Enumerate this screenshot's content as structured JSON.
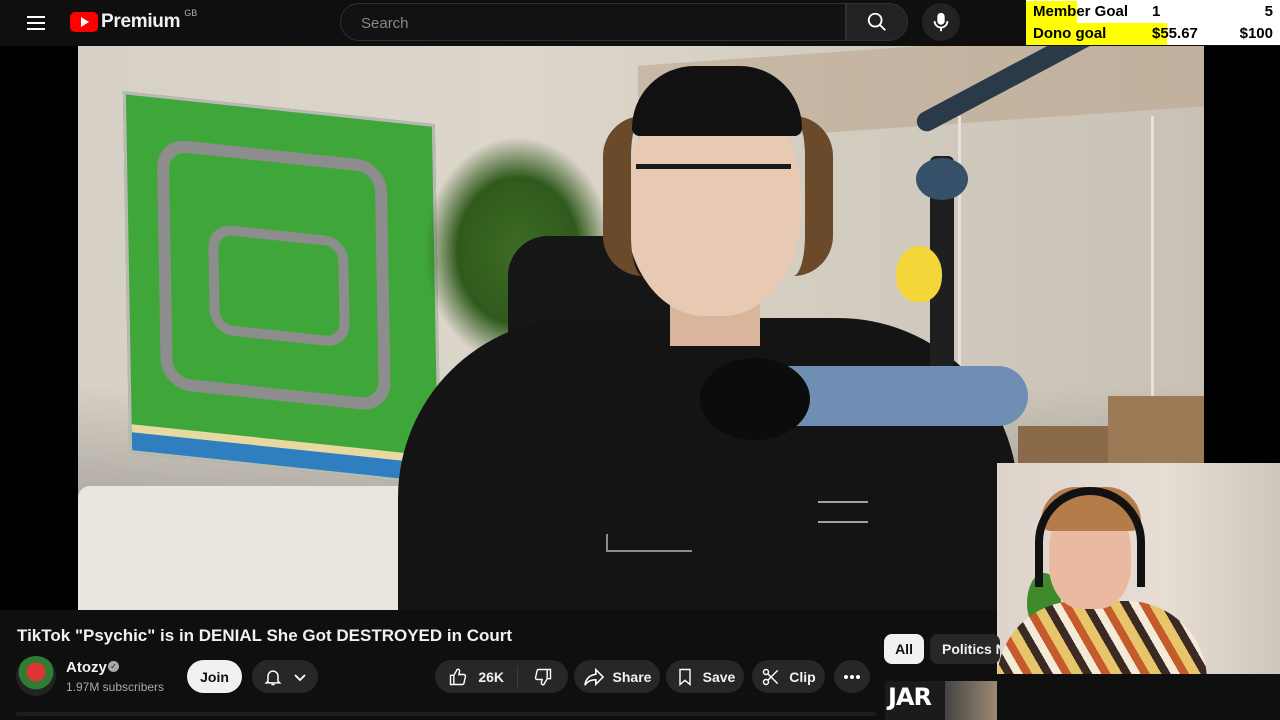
{
  "header": {
    "brand": "Premium",
    "region": "GB",
    "search_placeholder": "Search"
  },
  "overlay": {
    "rows": [
      {
        "label": "Member Goal",
        "current": "1",
        "target": "5",
        "progress": 0.2
      },
      {
        "label": "Dono goal",
        "current": "$55.67",
        "target": "$100",
        "progress": 0.5567
      }
    ]
  },
  "video": {
    "title": "TikTok \"Psychic\" is in DENIAL She Got DESTROYED in Court"
  },
  "channel": {
    "name": "Atozy",
    "subscribers": "1.97M subscribers",
    "join_label": "Join"
  },
  "actions": {
    "like_count": "26K",
    "share_label": "Share",
    "save_label": "Save",
    "clip_label": "Clip"
  },
  "chips": [
    "All",
    "Politics N"
  ],
  "thumbnail_text": "JAR",
  "icons": [
    "menu-icon",
    "youtube-logo-icon",
    "search-icon",
    "mic-icon",
    "bell-icon",
    "chevron-down-icon",
    "like-icon",
    "dislike-icon",
    "share-icon",
    "save-icon",
    "clip-icon",
    "more-icon"
  ],
  "colors": {
    "brand_red": "#ff0000",
    "background": "#0f0f0f",
    "goal_fill": "#ffff00"
  }
}
